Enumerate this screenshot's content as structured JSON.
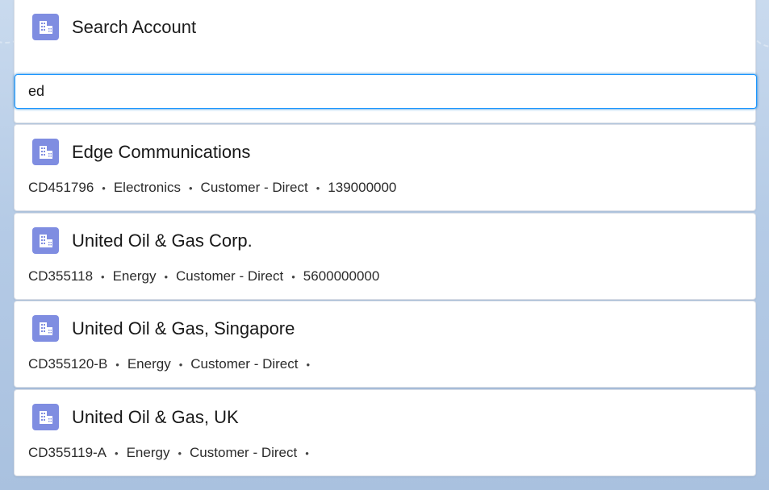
{
  "header": {
    "title": "Search Account",
    "icon": "account-building-icon"
  },
  "search": {
    "value": "ed"
  },
  "results": [
    {
      "name": "Edge Communications",
      "meta": [
        "CD451796",
        "Electronics",
        "Customer - Direct",
        "139000000"
      ]
    },
    {
      "name": "United Oil & Gas Corp.",
      "meta": [
        "CD355118",
        "Energy",
        "Customer - Direct",
        "5600000000"
      ]
    },
    {
      "name": "United Oil & Gas, Singapore",
      "meta": [
        "CD355120-B",
        "Energy",
        "Customer - Direct",
        ""
      ]
    },
    {
      "name": "United Oil & Gas, UK",
      "meta": [
        "CD355119-A",
        "Energy",
        "Customer - Direct",
        ""
      ]
    }
  ],
  "separator": "•",
  "colors": {
    "icon_bg": "#7f8de1",
    "focus_border": "#1b96ff"
  }
}
